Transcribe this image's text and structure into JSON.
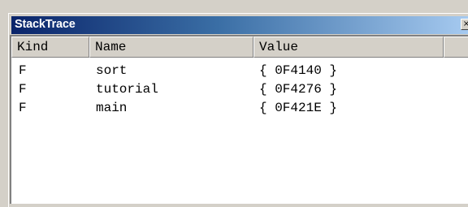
{
  "window": {
    "title": "StackTrace",
    "close_glyph": "×"
  },
  "table": {
    "columns": [
      "Kind",
      "Name",
      "Value"
    ],
    "rows": [
      {
        "kind": "F",
        "name": "sort",
        "value": "{ 0F4140 }"
      },
      {
        "kind": "F",
        "name": "tutorial",
        "value": "{ 0F4276 }"
      },
      {
        "kind": "F",
        "name": "main",
        "value": "{ 0F421E }"
      }
    ]
  },
  "colors": {
    "title_gradient_start": "#0a246a",
    "title_gradient_end": "#a6caf0",
    "face": "#d4d0c8",
    "list_bg": "#ffffff"
  }
}
